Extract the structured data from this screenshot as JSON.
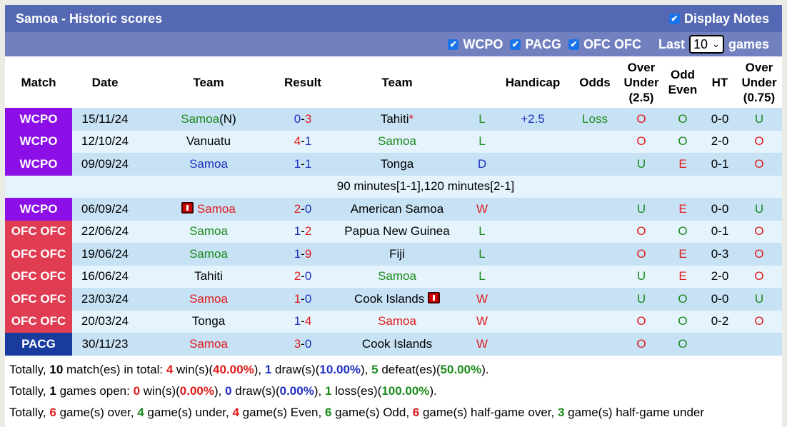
{
  "header": {
    "title": "Samoa - Historic scores",
    "display_notes_label": "Display Notes",
    "display_notes_checked": true
  },
  "filters": {
    "items": [
      {
        "label": "WCPO",
        "checked": true
      },
      {
        "label": "PACG",
        "checked": true
      },
      {
        "label": "OFC OFC",
        "checked": true
      }
    ],
    "last_label": "Last",
    "last_value": "10",
    "games_label": "games"
  },
  "columns": [
    "Match",
    "Date",
    "Team",
    "Result",
    "Team",
    "",
    "Handicap",
    "Odds",
    "Over Under (2.5)",
    "Odd Even",
    "HT",
    "Over Under (0.75)"
  ],
  "colors": {
    "WCPO": "#8b0fe6",
    "OFC OFC": "#e03c52",
    "PACG": "#1a3b9e"
  },
  "rows": [
    {
      "league": "WCPO",
      "date": "15/11/24",
      "home": "Samoa",
      "home_suffix": "(N)",
      "home_color": "g",
      "s1": "0",
      "s1c": "bl",
      "s2": "3",
      "s2c": "r",
      "away": "Tahiti",
      "away_mark": "*",
      "away_color": "k",
      "wl": "L",
      "wlc": "g",
      "hcp": "+2.5",
      "odds": "Loss",
      "ou": "O",
      "ouc": "r",
      "oe": "O",
      "oec": "g",
      "ht": "0-0",
      "ou2": "U",
      "ou2c": "g"
    },
    {
      "league": "WCPO",
      "date": "12/10/24",
      "home": "Vanuatu",
      "home_color": "k",
      "s1": "4",
      "s1c": "r",
      "s2": "1",
      "s2c": "bl",
      "away": "Samoa",
      "away_color": "g",
      "wl": "L",
      "wlc": "g",
      "hcp": "",
      "odds": "",
      "ou": "O",
      "ouc": "r",
      "oe": "O",
      "oec": "g",
      "ht": "2-0",
      "ou2": "O",
      "ou2c": "r"
    },
    {
      "league": "WCPO",
      "date": "09/09/24",
      "home": "Samoa",
      "home_color": "bl",
      "s1": "1",
      "s1c": "bl",
      "s2": "1",
      "s2c": "bl",
      "away": "Tonga",
      "away_color": "k",
      "wl": "D",
      "wlc": "bl",
      "hcp": "",
      "odds": "",
      "ou": "U",
      "ouc": "g",
      "oe": "E",
      "oec": "r",
      "ht": "0-1",
      "ou2": "O",
      "ou2c": "r",
      "note": "90 minutes[1-1],120 minutes[2-1]"
    },
    {
      "league": "WCPO",
      "date": "06/09/24",
      "home": "Samoa",
      "home_redcard": true,
      "home_color": "r",
      "s1": "2",
      "s1c": "r",
      "s2": "0",
      "s2c": "bl",
      "away": "American Samoa",
      "away_color": "k",
      "wl": "W",
      "wlc": "r",
      "hcp": "",
      "odds": "",
      "ou": "U",
      "ouc": "g",
      "oe": "E",
      "oec": "r",
      "ht": "0-0",
      "ou2": "U",
      "ou2c": "g"
    },
    {
      "league": "OFC OFC",
      "date": "22/06/24",
      "home": "Samoa",
      "home_color": "g",
      "s1": "1",
      "s1c": "bl",
      "s2": "2",
      "s2c": "r",
      "away": "Papua New Guinea",
      "away_color": "k",
      "wl": "L",
      "wlc": "g",
      "hcp": "",
      "odds": "",
      "ou": "O",
      "ouc": "r",
      "oe": "O",
      "oec": "g",
      "ht": "0-1",
      "ou2": "O",
      "ou2c": "r"
    },
    {
      "league": "OFC OFC",
      "date": "19/06/24",
      "home": "Samoa",
      "home_color": "g",
      "s1": "1",
      "s1c": "bl",
      "s2": "9",
      "s2c": "r",
      "away": "Fiji",
      "away_color": "k",
      "wl": "L",
      "wlc": "g",
      "hcp": "",
      "odds": "",
      "ou": "O",
      "ouc": "r",
      "oe": "E",
      "oec": "r",
      "ht": "0-3",
      "ou2": "O",
      "ou2c": "r"
    },
    {
      "league": "OFC OFC",
      "date": "16/06/24",
      "home": "Tahiti",
      "home_color": "k",
      "s1": "2",
      "s1c": "r",
      "s2": "0",
      "s2c": "bl",
      "away": "Samoa",
      "away_color": "g",
      "wl": "L",
      "wlc": "g",
      "hcp": "",
      "odds": "",
      "ou": "U",
      "ouc": "g",
      "oe": "E",
      "oec": "r",
      "ht": "2-0",
      "ou2": "O",
      "ou2c": "r"
    },
    {
      "league": "OFC OFC",
      "date": "23/03/24",
      "home": "Samoa",
      "home_color": "r",
      "s1": "1",
      "s1c": "r",
      "s2": "0",
      "s2c": "bl",
      "away": "Cook Islands",
      "away_redcard": true,
      "away_color": "k",
      "wl": "W",
      "wlc": "r",
      "hcp": "",
      "odds": "",
      "ou": "U",
      "ouc": "g",
      "oe": "O",
      "oec": "g",
      "ht": "0-0",
      "ou2": "U",
      "ou2c": "g"
    },
    {
      "league": "OFC OFC",
      "date": "20/03/24",
      "home": "Tonga",
      "home_color": "k",
      "s1": "1",
      "s1c": "bl",
      "s2": "4",
      "s2c": "r",
      "away": "Samoa",
      "away_color": "r",
      "wl": "W",
      "wlc": "r",
      "hcp": "",
      "odds": "",
      "ou": "O",
      "ouc": "r",
      "oe": "O",
      "oec": "g",
      "ht": "0-2",
      "ou2": "O",
      "ou2c": "r"
    },
    {
      "league": "PACG",
      "date": "30/11/23",
      "home": "Samoa",
      "home_color": "r",
      "s1": "3",
      "s1c": "r",
      "s2": "0",
      "s2c": "bl",
      "away": "Cook Islands",
      "away_color": "k",
      "wl": "W",
      "wlc": "r",
      "hcp": "",
      "odds": "",
      "ou": "O",
      "ouc": "r",
      "oe": "O",
      "oec": "g",
      "ht": "",
      "ou2": "",
      "ou2c": "k"
    }
  ],
  "summary": [
    [
      [
        "Totally, ",
        "k",
        0
      ],
      [
        "10",
        "k",
        1
      ],
      [
        " match(es) in total: ",
        "k",
        0
      ],
      [
        "4",
        "r",
        1
      ],
      [
        " win(s)(",
        "k",
        0
      ],
      [
        "40.00%",
        "r",
        1
      ],
      [
        "), ",
        "k",
        0
      ],
      [
        "1",
        "bl",
        1
      ],
      [
        " draw(s)(",
        "k",
        0
      ],
      [
        "10.00%",
        "bl",
        1
      ],
      [
        "), ",
        "k",
        0
      ],
      [
        "5",
        "g",
        1
      ],
      [
        " defeat(es)(",
        "k",
        0
      ],
      [
        "50.00%",
        "g",
        1
      ],
      [
        ").",
        "k",
        0
      ]
    ],
    [
      [
        "Totally, ",
        "k",
        0
      ],
      [
        "1",
        "k",
        1
      ],
      [
        " games open: ",
        "k",
        0
      ],
      [
        "0",
        "r",
        1
      ],
      [
        " win(s)(",
        "k",
        0
      ],
      [
        "0.00%",
        "r",
        1
      ],
      [
        "), ",
        "k",
        0
      ],
      [
        "0",
        "bl",
        1
      ],
      [
        " draw(s)(",
        "k",
        0
      ],
      [
        "0.00%",
        "bl",
        1
      ],
      [
        "), ",
        "k",
        0
      ],
      [
        "1",
        "g",
        1
      ],
      [
        " loss(es)(",
        "k",
        0
      ],
      [
        "100.00%",
        "g",
        1
      ],
      [
        ").",
        "k",
        0
      ]
    ],
    [
      [
        "Totally, ",
        "k",
        0
      ],
      [
        "6",
        "r",
        1
      ],
      [
        " game(s) over, ",
        "k",
        0
      ],
      [
        "4",
        "g",
        1
      ],
      [
        " game(s) under, ",
        "k",
        0
      ],
      [
        "4",
        "r",
        1
      ],
      [
        " game(s) Even, ",
        "k",
        0
      ],
      [
        "6",
        "g",
        1
      ],
      [
        " game(s) Odd, ",
        "k",
        0
      ],
      [
        "6",
        "r",
        1
      ],
      [
        " game(s) half-game over, ",
        "k",
        0
      ],
      [
        "3",
        "g",
        1
      ],
      [
        " game(s) half-game under",
        "k",
        0
      ]
    ]
  ]
}
